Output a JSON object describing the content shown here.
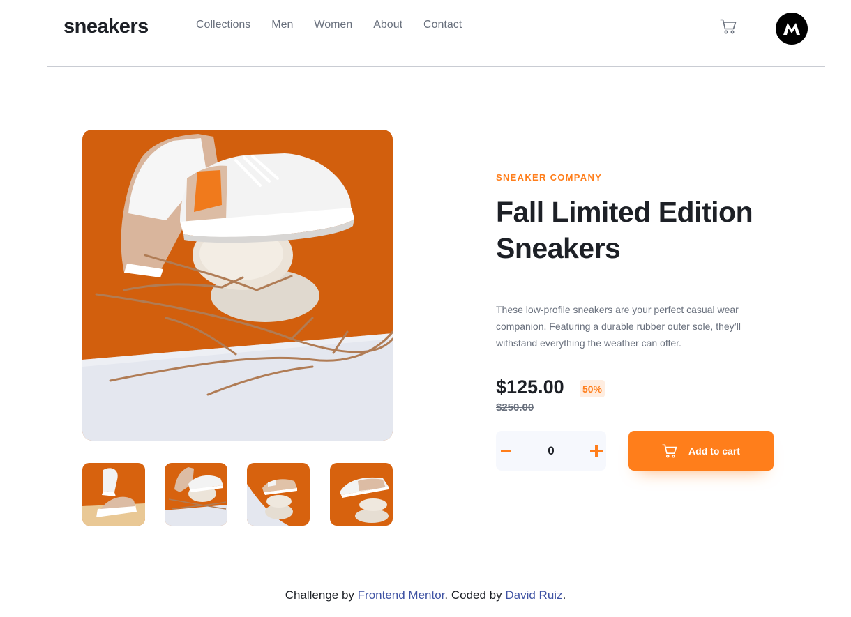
{
  "header": {
    "logo": "sneakers",
    "nav": [
      "Collections",
      "Men",
      "Women",
      "About",
      "Contact"
    ],
    "avatar_letter": "M"
  },
  "product": {
    "company": "SNEAKER COMPANY",
    "title": "Fall Limited Edition Sneakers",
    "description": "These low-profile sneakers are your perfect casual wear companion. Featuring a durable rubber outer sole, they’ll withstand everything the weather can offer.",
    "price": "$125.00",
    "discount": "50%",
    "original_price": "$250.00",
    "quantity": "0",
    "add_to_cart_label": "Add to cart"
  },
  "gallery": {
    "thumbnails": [
      "thumbnail-1",
      "thumbnail-2",
      "thumbnail-3",
      "thumbnail-4"
    ]
  },
  "footer": {
    "prefix": "Challenge by ",
    "link1": "Frontend Mentor",
    "middle": ". Coded by ",
    "link2": "David Ruiz",
    "suffix": "."
  },
  "colors": {
    "accent": "#ff7e1b",
    "accent_pale": "#ffede0",
    "text_dark": "#1d2026",
    "text_gray": "#69707d",
    "link": "#3e52a3"
  },
  "icons": {
    "cart": "cart-icon",
    "minus": "minus-icon",
    "plus": "plus-icon"
  }
}
